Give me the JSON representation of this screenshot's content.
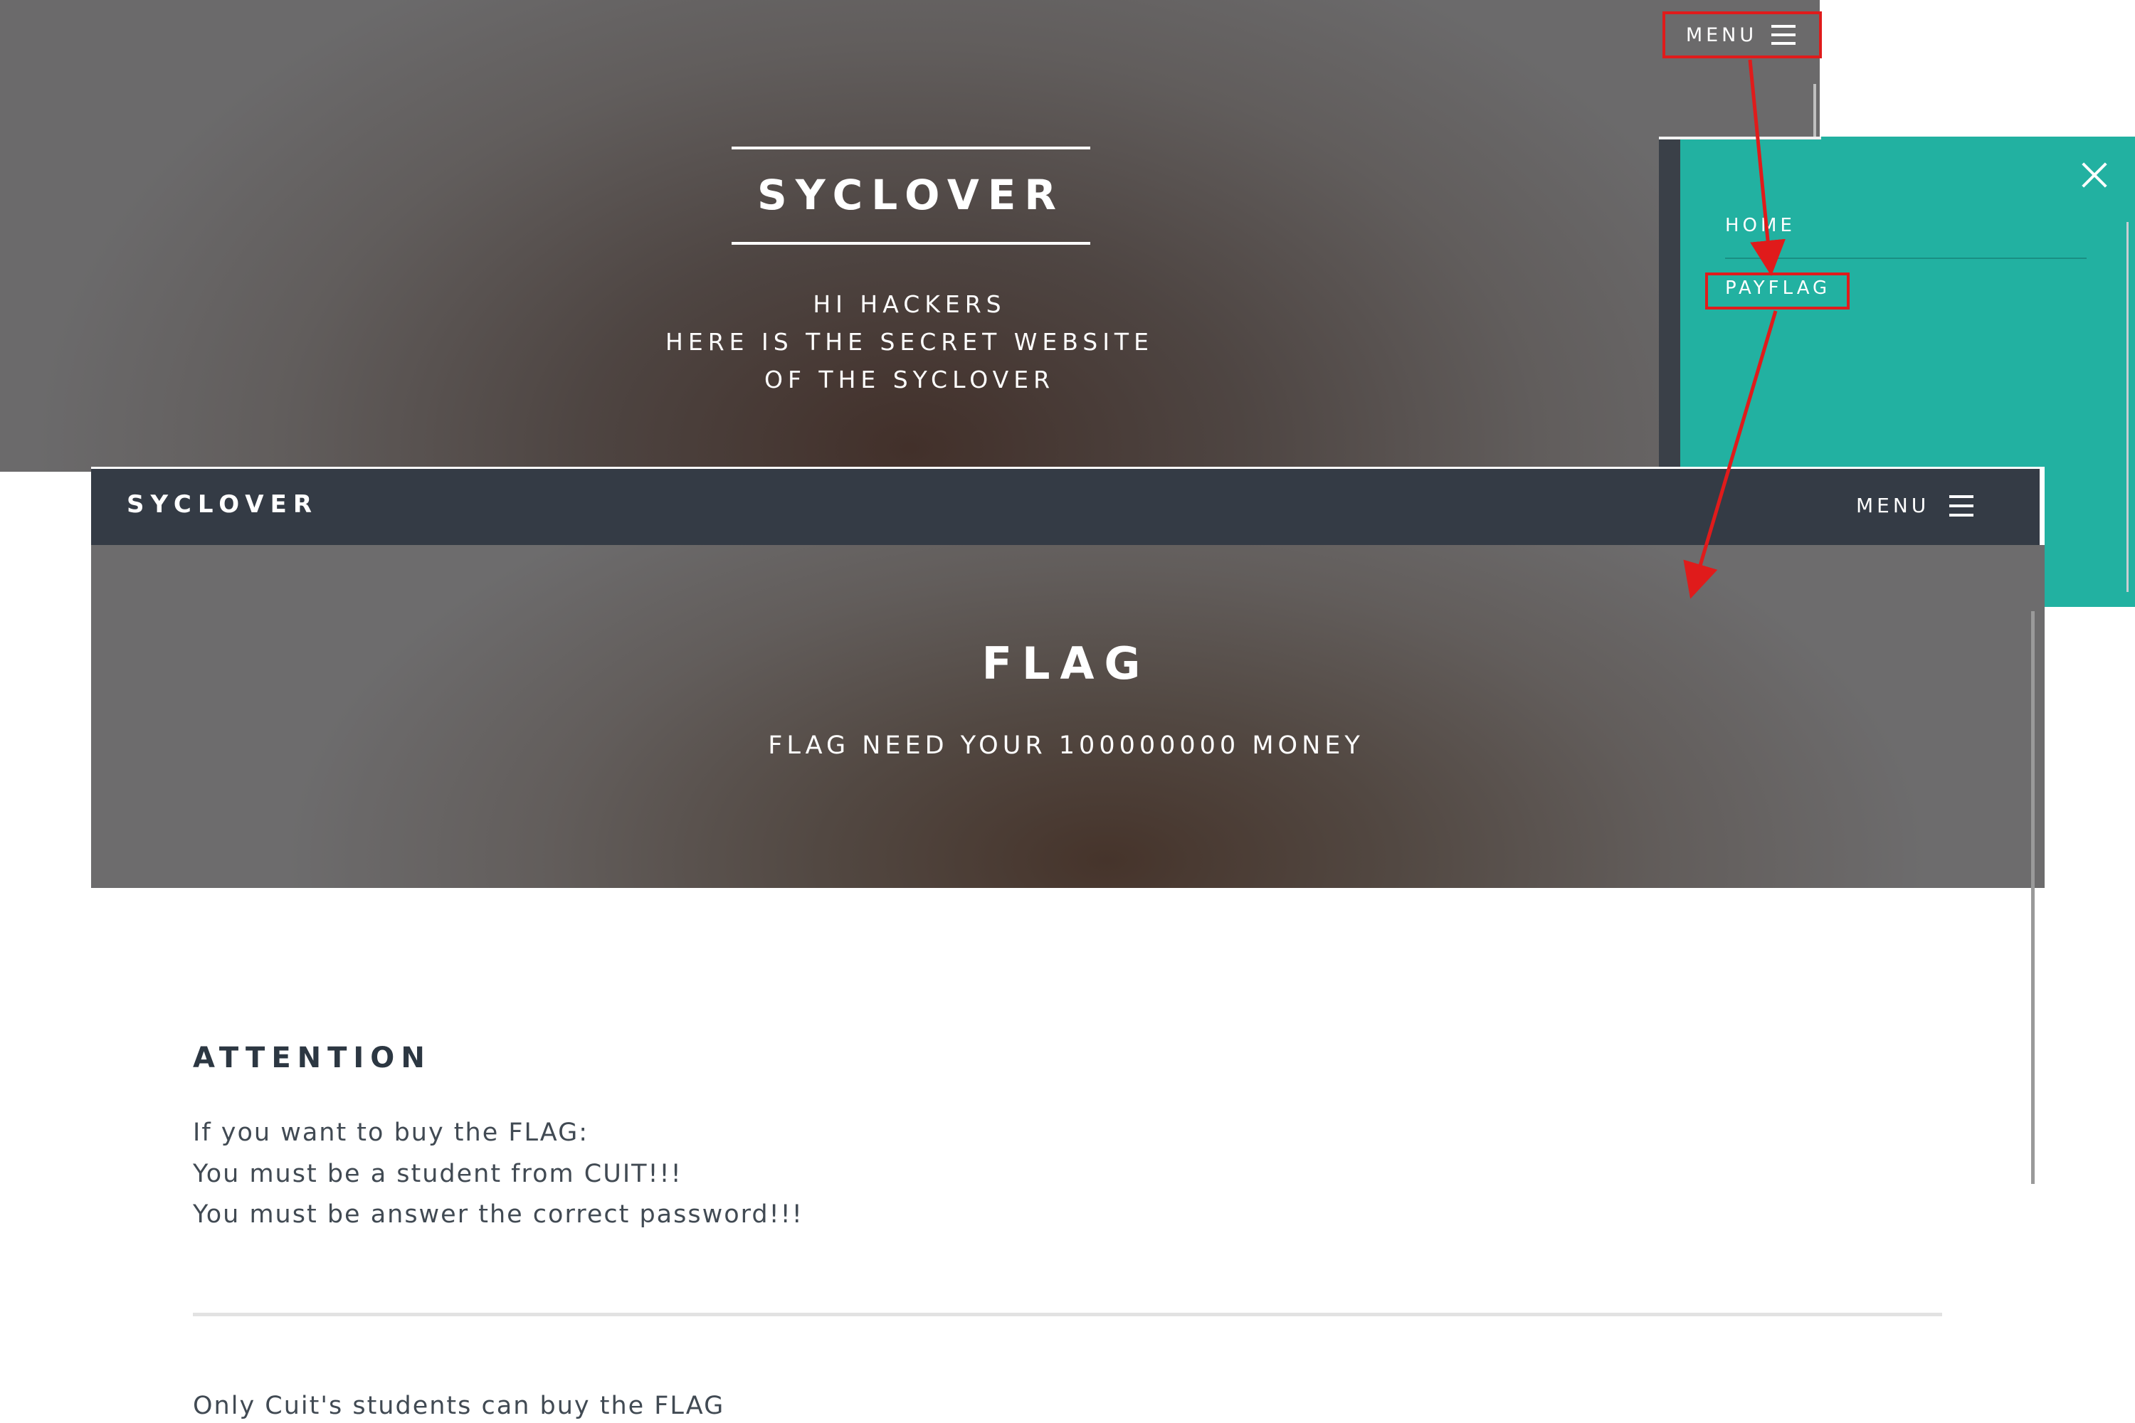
{
  "landing": {
    "title": "SYCLOVER",
    "subtitle_lines": [
      "HI HACKERS",
      "HERE IS THE SECRET WEBSITE",
      "OF THE SYCLOVER"
    ],
    "menu_label": "MENU",
    "menu_icon": "hamburger-icon"
  },
  "side_menu": {
    "close_icon": "close-icon",
    "items": [
      {
        "label": "HOME"
      },
      {
        "label": "PAYFLAG"
      }
    ],
    "bg_color": "#22b1a1"
  },
  "payflag_page": {
    "brand": "SYCLOVER",
    "menu_label": "MENU",
    "menu_icon": "hamburger-icon",
    "title": "FLAG",
    "subtitle": "FLAG NEED YOUR 100000000 MONEY",
    "attention": {
      "heading": "ATTENTION",
      "lines": [
        "If you want to buy the FLAG:",
        "You must be a student from CUIT!!!",
        "You must be answer the correct password!!!"
      ]
    },
    "footer_text": "Only Cuit's students can buy the FLAG",
    "navbar_color": "#343b45"
  },
  "annotation": {
    "color": "#e01b1b"
  }
}
